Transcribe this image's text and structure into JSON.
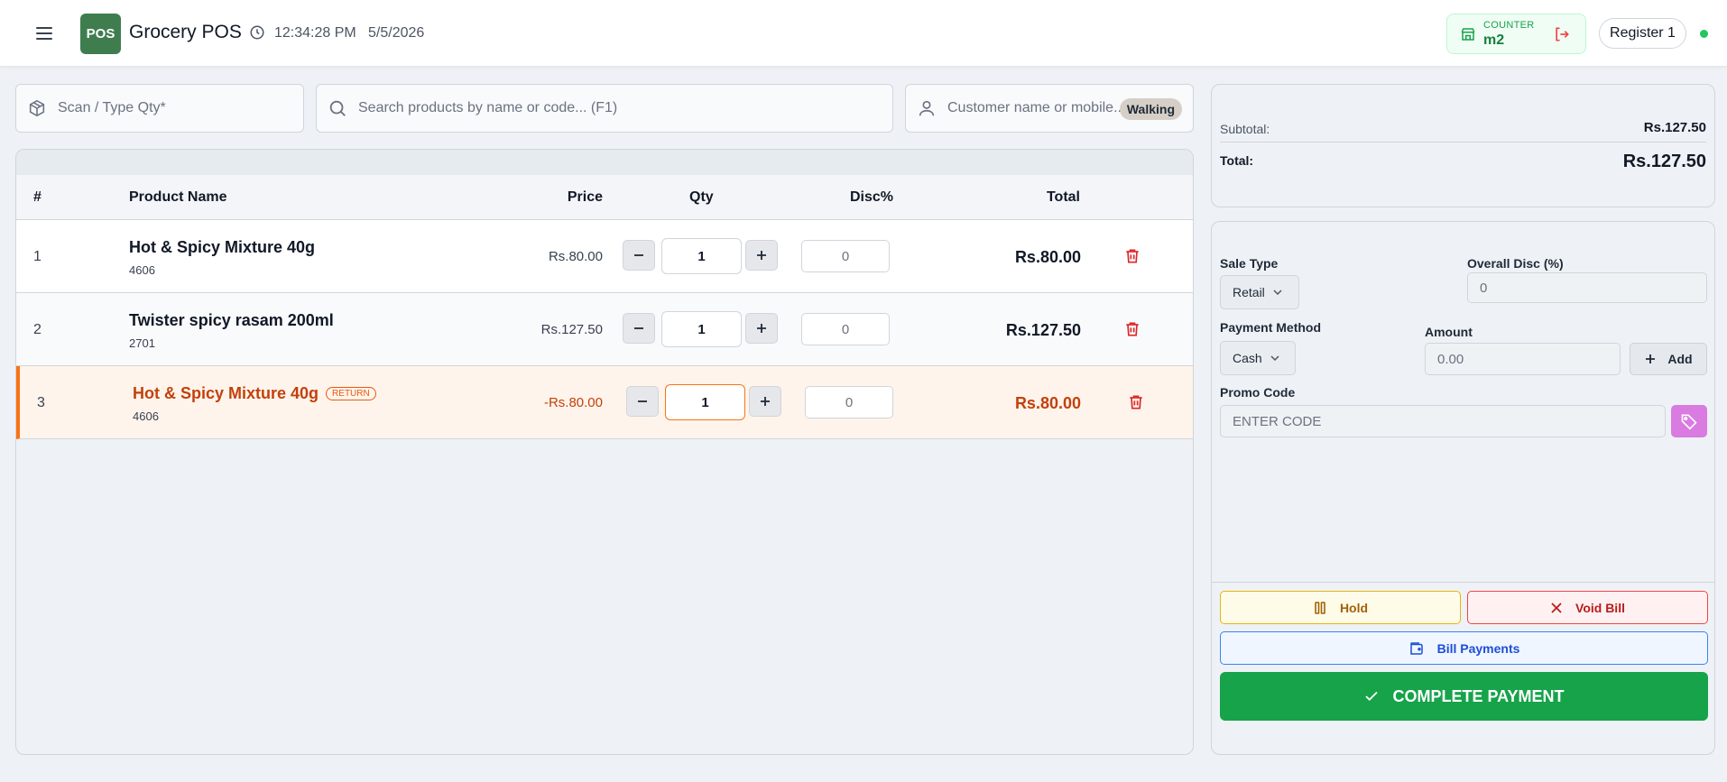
{
  "header": {
    "logo_text": "POS",
    "app_title": "Grocery POS",
    "time": "12:34:28 PM",
    "date": "5/5/2026",
    "counter_label": "COUNTER",
    "counter_value": "m2",
    "register_label": "Register 1",
    "status_color": "#22c55e"
  },
  "inputs": {
    "scan_placeholder": "Scan / Type Qty*",
    "search_placeholder": "Search products by name or code... (F1)",
    "customer_placeholder": "Customer name or mobile...",
    "customer_badge": "Walking"
  },
  "cart": {
    "columns": [
      "#",
      "Product Name",
      "Price",
      "Qty",
      "Disc%",
      "Total"
    ],
    "rows": [
      {
        "num": "1",
        "name": "Hot & Spicy Mixture 40g",
        "code": "4606",
        "price": "Rs.80.00",
        "qty": "1",
        "disc": "0",
        "total": "Rs.80.00"
      },
      {
        "num": "2",
        "name": "Twister spicy rasam 200ml",
        "code": "2701",
        "price": "Rs.127.50",
        "qty": "1",
        "disc": "0",
        "total": "Rs.127.50"
      },
      {
        "num": "3",
        "name": "Hot & Spicy Mixture 40g",
        "badge": "RETURN",
        "code": "4606",
        "price": "-Rs.80.00",
        "qty": "1",
        "disc": "0",
        "total": "Rs.80.00"
      }
    ]
  },
  "totals": {
    "subtotal_label": "Subtotal:",
    "subtotal_value": "Rs.127.50",
    "total_label": "Total:",
    "total_value": "Rs.127.50"
  },
  "payment": {
    "sale_type_label": "Sale Type",
    "sale_type_value": "Retail",
    "overall_disc_label": "Overall Disc (%)",
    "overall_disc_value": "0",
    "method_label": "Payment Method",
    "method_value": "Cash",
    "amount_label": "Amount",
    "amount_placeholder": "0.00",
    "add_label": "Add",
    "promo_label": "Promo Code",
    "promo_placeholder": "ENTER CODE",
    "hold_label": "Hold",
    "void_label": "Void Bill",
    "bill_payments_label": "Bill Payments",
    "complete_label": "COMPLETE PAYMENT"
  },
  "colors": {
    "brand": "#3f7d4f",
    "complete": "#16a34a",
    "return_accent": "#f97316",
    "delete": "#dc2626"
  },
  "icons": [
    "menu-icon",
    "clock-icon",
    "store-icon",
    "logout-icon",
    "package-icon",
    "search-icon",
    "user-icon",
    "minus-icon",
    "plus-icon",
    "trash-icon",
    "chevron-down-icon",
    "tag-icon",
    "pause-icon",
    "close-icon",
    "wallet-icon",
    "check-icon"
  ]
}
